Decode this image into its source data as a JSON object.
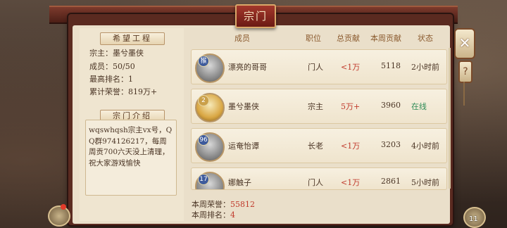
{
  "title": "宗门",
  "project": {
    "heading": "希望工程",
    "leader": "宗主：墨兮墨侠",
    "members": "成员：50/50",
    "rank": "最高排名：1",
    "honor": "累计荣誉：819万+"
  },
  "intro": {
    "heading": "宗门介绍",
    "text": "wqswhqsh宗主vx号，QQ群974126217，每周周贡700六天没上清理，祝大家游戏愉快"
  },
  "columns": {
    "member": "成员",
    "position": "职位",
    "total": "总贡献",
    "weekly": "本周贡献",
    "status": "状态"
  },
  "members": [
    {
      "name": "漂亮的哥哥",
      "position": "门人",
      "total": "<1万",
      "weekly": "5118",
      "status": "2小时前",
      "badge": "猴",
      "avatar_style": "gray",
      "status_color": "#4a3424"
    },
    {
      "name": "墨兮墨侠",
      "position": "宗主",
      "total": "5万+",
      "weekly": "3960",
      "status": "在线",
      "badge": "2",
      "avatar_style": "gold",
      "status_color": "#2e8b57"
    },
    {
      "name": "运奄怡谭",
      "position": "长老",
      "total": "<1万",
      "weekly": "3203",
      "status": "4小时前",
      "badge": "96",
      "avatar_style": "gray",
      "status_color": "#4a3424"
    },
    {
      "name": "娜触子",
      "position": "门人",
      "total": "<1万",
      "weekly": "2861",
      "status": "5小时前",
      "badge": "17",
      "avatar_style": "gray",
      "status_color": "#4a3424"
    }
  ],
  "footer": {
    "week_honor_label": "本周荣誉：",
    "week_honor_value": "55812",
    "week_rank_label": "本周排名：",
    "week_rank_value": "4"
  },
  "side": {
    "close_icon": "close-x",
    "help_icon": "question-mark",
    "count": "11"
  }
}
